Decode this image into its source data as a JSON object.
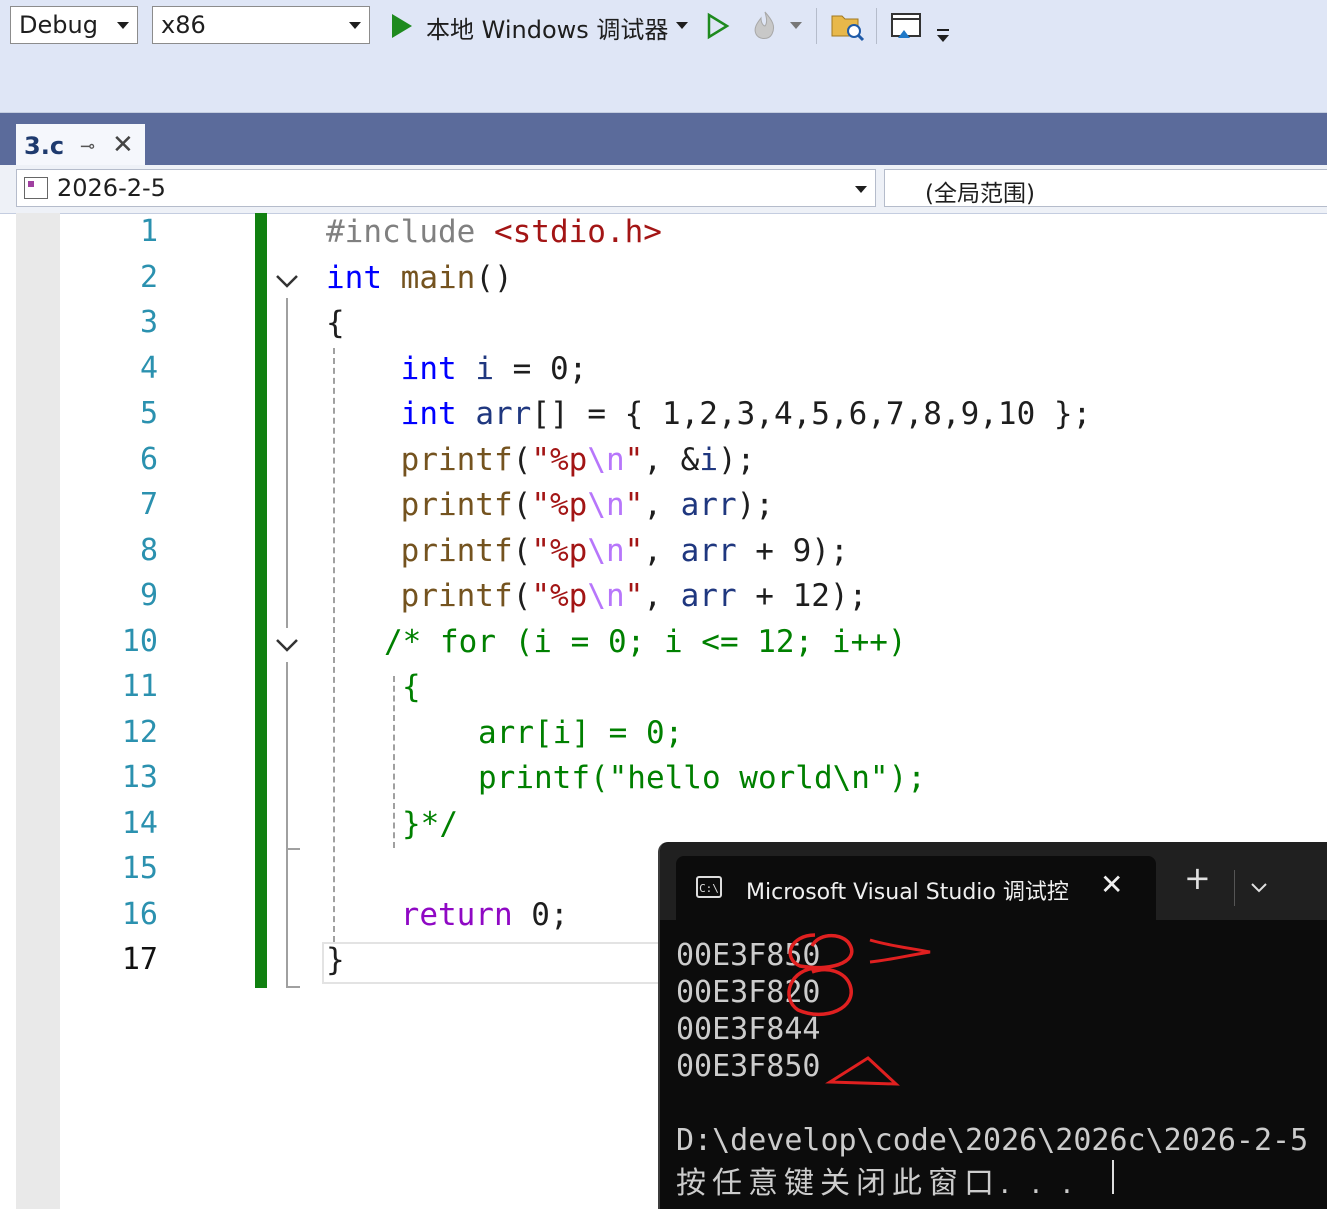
{
  "toolbar": {
    "config": "Debug",
    "platform": "x86",
    "run_label": "本地 Windows 调试器"
  },
  "tab": {
    "name": "3.c",
    "pin": "⊸",
    "close": "✕"
  },
  "navbar": {
    "project": "2026-2-5",
    "scope": "(全局范围)"
  },
  "editor": {
    "lines": [
      {
        "n": "1"
      },
      {
        "n": "2"
      },
      {
        "n": "3"
      },
      {
        "n": "4"
      },
      {
        "n": "5"
      },
      {
        "n": "6"
      },
      {
        "n": "7"
      },
      {
        "n": "8"
      },
      {
        "n": "9"
      },
      {
        "n": "10"
      },
      {
        "n": "11"
      },
      {
        "n": "12"
      },
      {
        "n": "13"
      },
      {
        "n": "14"
      },
      {
        "n": "15"
      },
      {
        "n": "16"
      },
      {
        "n": "17"
      }
    ],
    "tokens": {
      "l1_a": "#include",
      "l1_b": "<stdio.h>",
      "l2_a": "int",
      "l2_b": "main",
      "l2_c": "()",
      "l3": "{",
      "l4_a": "int",
      "l4_b": "i",
      "l4_c": " = 0;",
      "l5_a": "int",
      "l5_b": "arr",
      "l5_c": "[] = { 1,2,3,4,5,6,7,8,9,10 };",
      "printf": "printf",
      "str_open": "\"%p",
      "esc_n": "\\n",
      "str_close": "\"",
      "l6_rest": ", &",
      "l6_var": "i",
      "l6_end": ");",
      "arr": "arr",
      "l7_end": ");",
      "l8_end": " + 9);",
      "l9_end": " + 12);",
      "l10": "/* for (i = 0; i <= 12; i++)",
      "l11": "{",
      "l12": "arr[i] = 0;",
      "l13": "printf(\"hello world\\n\");",
      "l14": "}*/",
      "l16_a": "return",
      "l16_b": " 0;",
      "l17": "}"
    }
  },
  "console": {
    "title": "Microsoft Visual Studio 调试控",
    "icon": "C:\\",
    "output": [
      "00E3F850",
      "00E3F820",
      "00E3F844",
      "00E3F850",
      "",
      "D:\\develop\\code\\2026\\2026c\\2026-2-5",
      "按任意键关闭此窗口. . ."
    ]
  },
  "colors": {
    "keyword": "#0000ff",
    "function": "#74531f",
    "variable": "#1f377f",
    "string": "#a31515",
    "comment": "#008000",
    "change_bar": "#108010",
    "annotation": "#e02020"
  }
}
